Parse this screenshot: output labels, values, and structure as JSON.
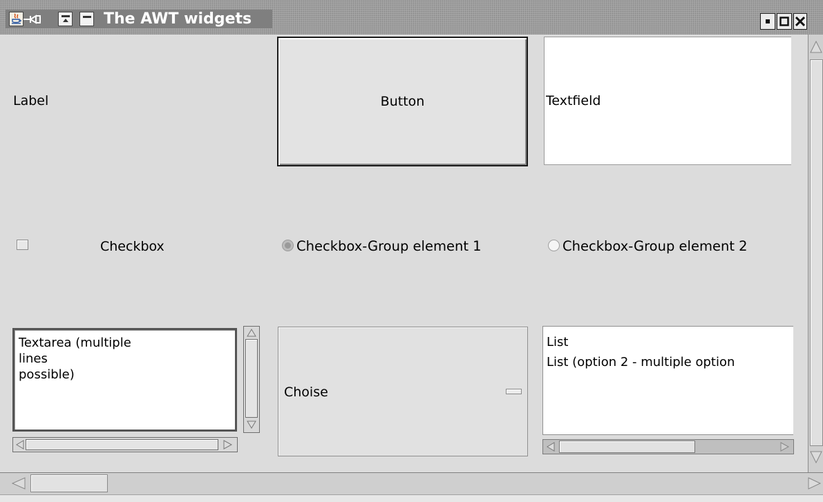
{
  "window": {
    "title": "The AWT widgets"
  },
  "widgets": {
    "label_text": "Label",
    "button_label": "Button",
    "textfield_value": "Textfield",
    "checkbox_label": "Checkbox",
    "checkbox_checked": false,
    "radio1_label": "Checkbox-Group element 1",
    "radio1_selected": true,
    "radio2_label": "Checkbox-Group element 2",
    "radio2_selected": false,
    "textarea_value": "Textarea (multiple\nlines\npossible)",
    "choice_selected": "Choise",
    "list_items": [
      "List",
      "List (option 2 - multiple option"
    ]
  },
  "colors": {
    "titlebar": "#7f7f7f",
    "background": "#dcdcdc",
    "field_background": "#ffffff"
  },
  "icons": [
    "java-app-icon",
    "pin-icon",
    "shade-up-icon",
    "minimize-icon",
    "iconify-icon",
    "maximize-icon",
    "close-icon"
  ]
}
